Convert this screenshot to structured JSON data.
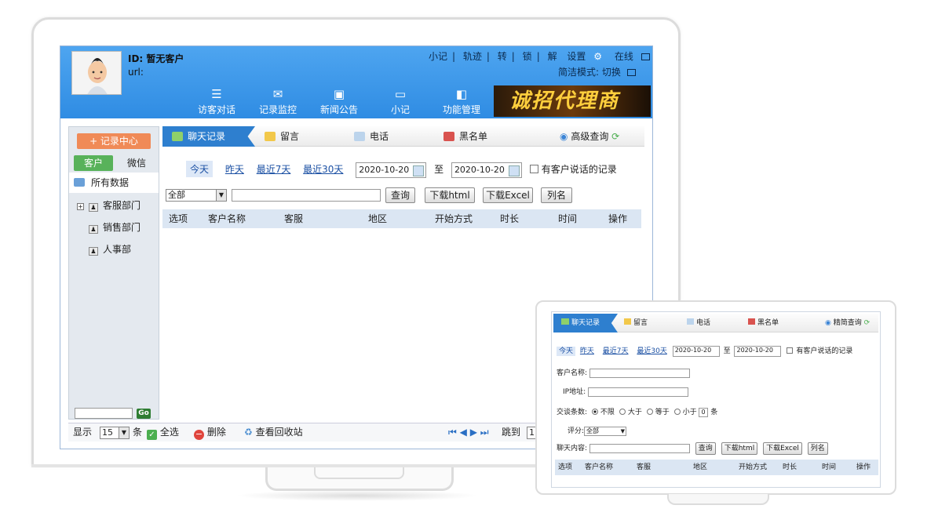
{
  "header": {
    "id_label": "ID: 暂无客户",
    "url_label": "url:",
    "top_links": [
      "小记",
      "|",
      "轨迹",
      "|",
      "转",
      "|",
      "锁",
      "|",
      "解",
      "设置",
      "在线"
    ],
    "mode_label": "简洁模式: 切换",
    "nav": [
      "访客对话",
      "记录监控",
      "新闻公告",
      "小记",
      "功能管理"
    ],
    "banner_text": "诚招代理商"
  },
  "sidebar": {
    "record_center": "+ 记录中心",
    "tab_customer": "客户",
    "tab_wechat": "微信",
    "all_data": "所有数据",
    "depts": [
      "客服部门",
      "销售部门",
      "人事部"
    ],
    "go_label": "Go",
    "expand_symbol": "+"
  },
  "main": {
    "tabs": [
      "聊天记录",
      "留言",
      "电话",
      "黑名单"
    ],
    "advanced_query": "高级查询",
    "quick_filters": [
      "今天",
      "昨天",
      "最近7天",
      "最近30天"
    ],
    "date_from": "2020-10-20",
    "to_label": "至",
    "date_to": "2020-10-20",
    "has_customer_speech": "有客户说话的记录",
    "select_all_value": "全部",
    "buttons": [
      "查询",
      "下载html",
      "下载Excel",
      "列名"
    ],
    "columns": [
      "选项",
      "客户名称",
      "客服",
      "地区",
      "开始方式",
      "时长",
      "时间",
      "操作"
    ]
  },
  "footer": {
    "show_label": "显示",
    "page_size": "15",
    "unit_label": "条",
    "select_all": "全选",
    "delete": "删除",
    "recycle": "查看回收站",
    "jump": "跳到",
    "page_value": "1"
  },
  "laptop": {
    "tabs": [
      "聊天记录",
      "留言",
      "电话",
      "黑名单"
    ],
    "simple_query": "精简查询",
    "quick_filters": [
      "今天",
      "昨天",
      "最近7天",
      "最近30天"
    ],
    "date_from": "2020-10-20",
    "to_label": "至",
    "date_to": "2020-10-20",
    "has_customer_speech": "有客户说话的记录",
    "customer_name_label": "客户名称:",
    "ip_label": "IP地址:",
    "msg_count_label": "交谈条数:",
    "radio_options": [
      "不限",
      "大于",
      "等于",
      "小于"
    ],
    "count_value": "0",
    "count_unit": "条",
    "rating_label": "评分:",
    "rating_value": "全部",
    "chat_content_label": "聊天内容:",
    "buttons": [
      "查询",
      "下载html",
      "下载Excel",
      "列名"
    ],
    "columns": [
      "选项",
      "客户名称",
      "客服",
      "地区",
      "开始方式",
      "时长",
      "时间",
      "操作"
    ]
  }
}
